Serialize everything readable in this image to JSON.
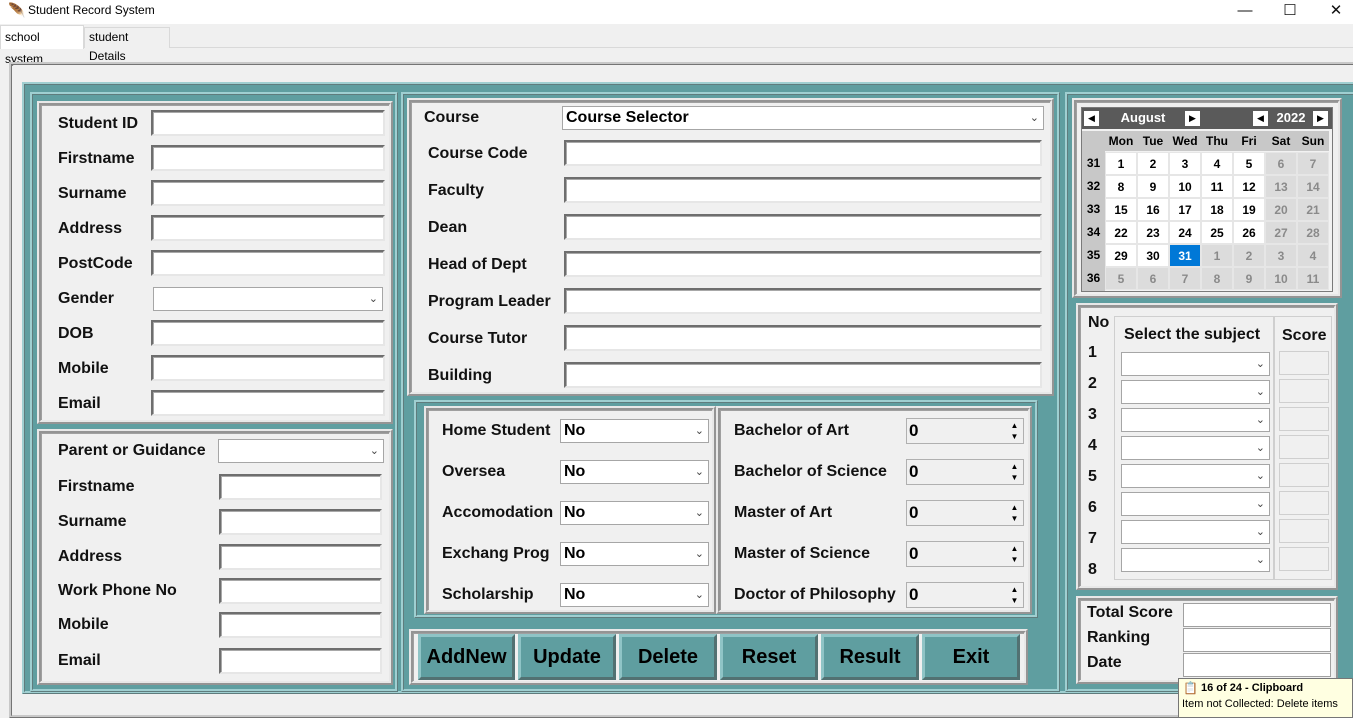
{
  "window": {
    "title": "Student Record System",
    "minimize": "—",
    "maximize": "☐",
    "close": "✕"
  },
  "tabs": [
    {
      "label": "school system"
    },
    {
      "label": "student Details"
    }
  ],
  "student": {
    "fields": [
      {
        "label": "Student ID",
        "value": ""
      },
      {
        "label": "Firstname",
        "value": ""
      },
      {
        "label": "Surname",
        "value": ""
      },
      {
        "label": "Address",
        "value": ""
      },
      {
        "label": "PostCode",
        "value": ""
      },
      {
        "label": "Gender",
        "value": ""
      },
      {
        "label": "DOB",
        "value": ""
      },
      {
        "label": "Mobile",
        "value": ""
      },
      {
        "label": "Email",
        "value": ""
      }
    ]
  },
  "parent": {
    "select_label": "Parent or Guidance",
    "select_value": "",
    "fields": [
      {
        "label": "Firstname",
        "value": ""
      },
      {
        "label": "Surname",
        "value": ""
      },
      {
        "label": "Address",
        "value": ""
      },
      {
        "label": "Work Phone No",
        "value": ""
      },
      {
        "label": "Mobile",
        "value": ""
      },
      {
        "label": "Email",
        "value": ""
      }
    ]
  },
  "course": {
    "label": "Course",
    "selector_value": "Course Selector",
    "fields": [
      {
        "label": "Course Code",
        "value": ""
      },
      {
        "label": "Faculty",
        "value": ""
      },
      {
        "label": "Dean",
        "value": ""
      },
      {
        "label": "Head of Dept",
        "value": ""
      },
      {
        "label": "Program Leader",
        "value": ""
      },
      {
        "label": "Course Tutor",
        "value": ""
      },
      {
        "label": "Building",
        "value": ""
      }
    ]
  },
  "options": [
    {
      "label": "Home Student",
      "value": "No"
    },
    {
      "label": "Oversea",
      "value": "No"
    },
    {
      "label": "Accomodation",
      "value": "No"
    },
    {
      "label": "Exchang Prog",
      "value": "No"
    },
    {
      "label": "Scholarship",
      "value": "No"
    }
  ],
  "degrees": [
    {
      "label": "Bachelor of Art",
      "value": "0"
    },
    {
      "label": "Bachelor of Science",
      "value": "0"
    },
    {
      "label": "Master of Art",
      "value": "0"
    },
    {
      "label": "Master of Science",
      "value": "0"
    },
    {
      "label": "Doctor of Philosophy",
      "value": "0"
    }
  ],
  "buttons": {
    "addnew": "AddNew",
    "update": "Update",
    "delete": "Delete",
    "reset": "Reset",
    "result": "Result",
    "exit": "Exit"
  },
  "calendar": {
    "month": "August",
    "year": "2022",
    "prev": "◀",
    "next": "▶",
    "weekdays": [
      "Mon",
      "Tue",
      "Wed",
      "Thu",
      "Fri",
      "Sat",
      "Sun"
    ],
    "weeks": [
      {
        "no": "31",
        "days": [
          "1",
          "2",
          "3",
          "4",
          "5",
          "6",
          "7"
        ]
      },
      {
        "no": "32",
        "days": [
          "8",
          "9",
          "10",
          "11",
          "12",
          "13",
          "14"
        ]
      },
      {
        "no": "33",
        "days": [
          "15",
          "16",
          "17",
          "18",
          "19",
          "20",
          "21"
        ]
      },
      {
        "no": "34",
        "days": [
          "22",
          "23",
          "24",
          "25",
          "26",
          "27",
          "28"
        ]
      },
      {
        "no": "35",
        "days": [
          "29",
          "30",
          "31",
          "1",
          "2",
          "3",
          "4"
        ]
      },
      {
        "no": "36",
        "days": [
          "5",
          "6",
          "7",
          "8",
          "9",
          "10",
          "11"
        ]
      }
    ],
    "selected": "31",
    "selected_color": "#0078d7"
  },
  "subjects": {
    "no_header": "No",
    "subject_header": "Select the subject",
    "score_header": "Score",
    "rows": [
      {
        "no": "1",
        "subject": "",
        "score": ""
      },
      {
        "no": "2",
        "subject": "",
        "score": ""
      },
      {
        "no": "3",
        "subject": "",
        "score": ""
      },
      {
        "no": "4",
        "subject": "",
        "score": ""
      },
      {
        "no": "5",
        "subject": "",
        "score": ""
      },
      {
        "no": "6",
        "subject": "",
        "score": ""
      },
      {
        "no": "7",
        "subject": "",
        "score": ""
      },
      {
        "no": "8",
        "subject": "",
        "score": ""
      }
    ]
  },
  "summary": [
    {
      "label": "Total Score",
      "value": ""
    },
    {
      "label": "Ranking",
      "value": ""
    },
    {
      "label": "Date",
      "value": ""
    }
  ],
  "clipboard_tip": {
    "title": "16 of 24 - Clipboard",
    "body": "Item not Collected: Delete items"
  },
  "colors": {
    "frame": "#5f9ea0",
    "calendar_header": "#5a5a5a"
  }
}
